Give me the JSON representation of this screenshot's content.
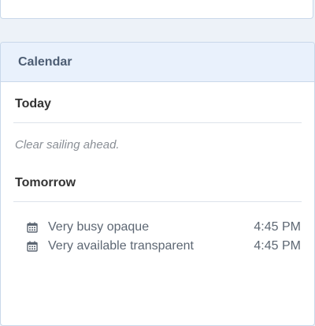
{
  "calendar": {
    "title": "Calendar",
    "sections": [
      {
        "heading": "Today",
        "empty_text": "Clear sailing ahead."
      },
      {
        "heading": "Tomorrow",
        "events": [
          {
            "icon": "calendar-icon",
            "title": "Very busy opaque",
            "time": "4:45 PM"
          },
          {
            "icon": "calendar-icon",
            "title": "Very available transparent",
            "time": "4:45 PM"
          }
        ]
      }
    ]
  },
  "colors": {
    "header_bg": "#e9f1fc",
    "border": "#c9d8ea",
    "title_text": "#4d5d73",
    "muted_text": "#8a8f96"
  }
}
